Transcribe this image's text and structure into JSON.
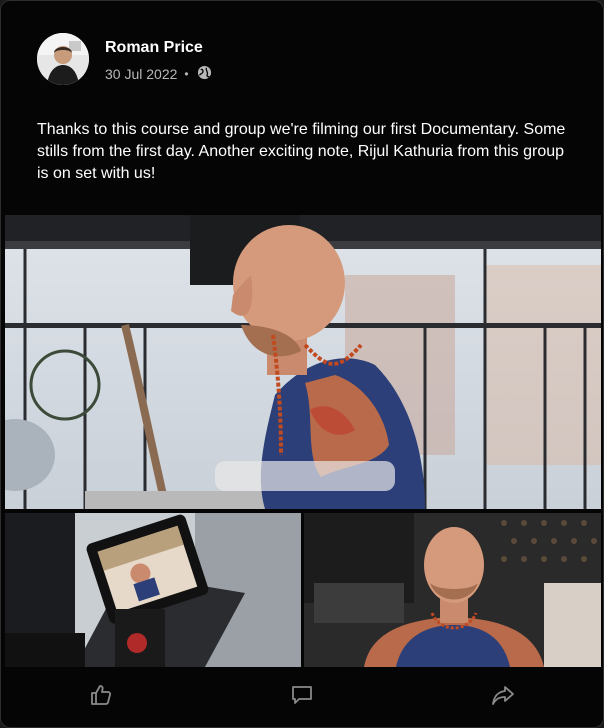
{
  "post": {
    "author": "Roman Price",
    "date": "30 Jul 2022",
    "separator": "•",
    "visibility_icon": "globe-icon",
    "body": "Thanks to this course and group we're filming our first Documentary. Some stills from the first day. Another exciting note, Rijul Kathuria from this group is on set with us!"
  },
  "media": {
    "images": [
      {
        "name": "main-still",
        "depicts": "bald man with beard and beads"
      },
      {
        "name": "camera-still",
        "depicts": "camera monitor"
      },
      {
        "name": "portrait-still",
        "depicts": "man with eyes closed"
      }
    ]
  },
  "actions": [
    {
      "icon": "thumbs-up-icon"
    },
    {
      "icon": "comment-icon"
    },
    {
      "icon": "share-icon"
    }
  ],
  "colors": {
    "card_bg": "#050505",
    "text": "#ffffff",
    "muted": "#b8b8b8",
    "icon": "#8a8a8a"
  }
}
